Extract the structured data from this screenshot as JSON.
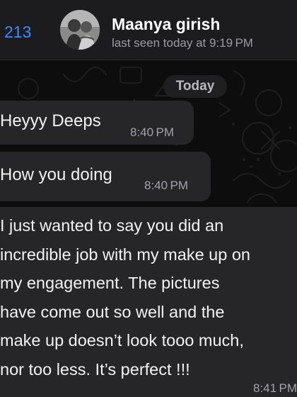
{
  "header": {
    "back_count": "213",
    "contact_name": "Maanya girish",
    "status": "last seen today at 9:19 PM"
  },
  "chat": {
    "date_label": "Today",
    "messages": [
      {
        "lines": [
          "Heyyy Deeps"
        ],
        "time": "8:40 PM"
      },
      {
        "lines": [
          "How you doing"
        ],
        "time": "8:40 PM"
      },
      {
        "lines": [
          "I just wanted to say you did an",
          "incredible job with my make up on",
          "my engagement. The pictures",
          "have come out so well and the",
          "make up doesn’t look tooo much,",
          "nor too less. It’s perfect !!!"
        ],
        "time": "8:41 PM"
      }
    ]
  },
  "colors": {
    "accent": "#3a8cff",
    "bubble": "#262628",
    "header_bg": "#1c1c1e"
  },
  "icons": [
    "back-chevron-icon",
    "avatar-photo"
  ]
}
